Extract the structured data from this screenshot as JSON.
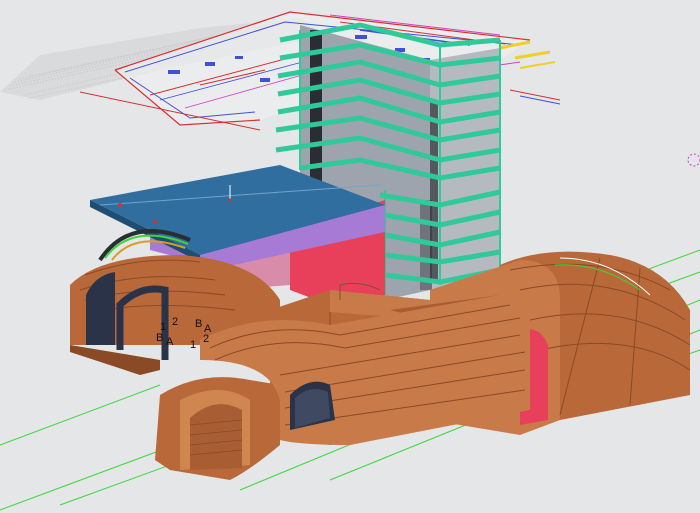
{
  "viewport": {
    "background": "#e4e6e7",
    "description_icons": [
      "orbit-cursor-icon"
    ]
  },
  "colors": {
    "tunnel": "#b9683a",
    "tunnel_dark": "#8a4a26",
    "tunnel_light": "#c97a49",
    "rebar_green": "#2fc99a",
    "column_gray": "#9ea4ad",
    "slab_blue": "#2f6e9f",
    "slab_purple": "#a77ad6",
    "pink_wall": "#e8405a",
    "grid_green": "#3bd63b",
    "plan_red": "#d83030",
    "plan_blue": "#4050d8",
    "plan_magenta": "#d040c0",
    "plan_yellow": "#f0d020"
  },
  "marker_labels": [
    {
      "id": "l1",
      "text": "1"
    },
    {
      "id": "l2",
      "text": "2"
    },
    {
      "id": "l3",
      "text": "B"
    },
    {
      "id": "l4",
      "text": "A"
    },
    {
      "id": "l5",
      "text": "B"
    },
    {
      "id": "l6",
      "text": "A"
    },
    {
      "id": "l7",
      "text": "1"
    },
    {
      "id": "l8",
      "text": "2"
    }
  ]
}
